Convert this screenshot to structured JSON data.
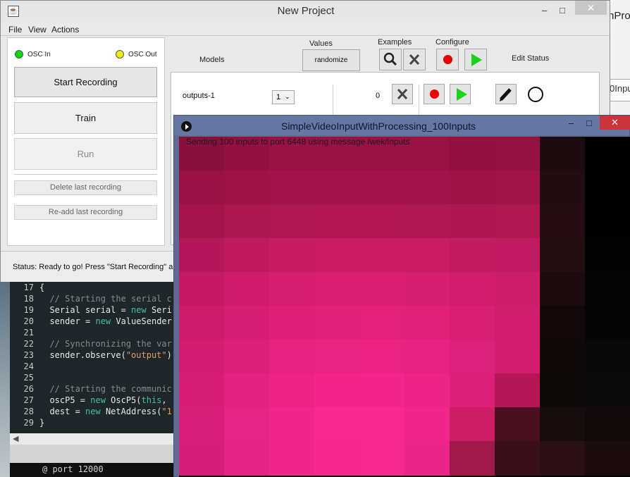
{
  "main_window": {
    "title": "New Project",
    "menu": [
      "File",
      "View",
      "Actions"
    ],
    "minimize": "‒",
    "maximize": "□",
    "close": "✕",
    "osc_in": {
      "label": "OSC In",
      "color": "#00dd00"
    },
    "osc_out": {
      "label": "OSC Out",
      "color": "#eeee00"
    },
    "buttons": {
      "start_recording": "Start Recording",
      "train": "Train",
      "run": "Run",
      "delete_last": "Delete last recording",
      "readd_last": "Re-add last recording"
    },
    "headers": {
      "models": "Models",
      "values": "Values",
      "examples": "Examples",
      "configure": "Configure",
      "edit_status": "Edit  Status"
    },
    "randomize": "randomize",
    "model_row": {
      "name": "outputs-1",
      "value": "1",
      "examples": "0"
    },
    "status": "Status:  Ready to go! Press \"Start Recording\" a"
  },
  "right_window": {
    "title_fragment": "nProc",
    "text_fragment": "0Inpu"
  },
  "editor": {
    "lines": [
      {
        "n": "17",
        "parts": [
          {
            "c": "tx",
            "t": "{"
          }
        ]
      },
      {
        "n": "18",
        "parts": [
          {
            "c": "cm",
            "t": "  // Starting the serial c"
          }
        ]
      },
      {
        "n": "19",
        "parts": [
          {
            "c": "tx",
            "t": "  Serial serial = "
          },
          {
            "c": "kw",
            "t": "new"
          },
          {
            "c": "tx",
            "t": " Seri"
          }
        ]
      },
      {
        "n": "20",
        "parts": [
          {
            "c": "tx",
            "t": "  sender = "
          },
          {
            "c": "kw",
            "t": "new"
          },
          {
            "c": "tx",
            "t": " ValueSender"
          }
        ]
      },
      {
        "n": "21",
        "parts": []
      },
      {
        "n": "22",
        "parts": [
          {
            "c": "cm",
            "t": "  // Synchronizing the var"
          }
        ]
      },
      {
        "n": "23",
        "parts": [
          {
            "c": "tx",
            "t": "  sender.observe("
          },
          {
            "c": "st",
            "t": "\"output\""
          },
          {
            "c": "tx",
            "t": ")"
          }
        ]
      },
      {
        "n": "24",
        "parts": []
      },
      {
        "n": "25",
        "parts": []
      },
      {
        "n": "26",
        "parts": [
          {
            "c": "cm",
            "t": "  // Starting the communic"
          }
        ]
      },
      {
        "n": "27",
        "parts": [
          {
            "c": "tx",
            "t": "  oscP5 = "
          },
          {
            "c": "kw",
            "t": "new"
          },
          {
            "c": "tx",
            "t": " OscP5("
          },
          {
            "c": "kw",
            "t": "this"
          },
          {
            "c": "tx",
            "t": ","
          }
        ]
      },
      {
        "n": "28",
        "parts": [
          {
            "c": "tx",
            "t": "  dest = "
          },
          {
            "c": "kw",
            "t": "new"
          },
          {
            "c": "tx",
            "t": " NetAddress("
          },
          {
            "c": "st",
            "t": "\"1"
          }
        ]
      },
      {
        "n": "29",
        "parts": [
          {
            "c": "tx",
            "t": "}"
          }
        ]
      }
    ],
    "console": "@ port 12000"
  },
  "sketch_window": {
    "title": "SimpleVideoInputWithProcessing_100Inputs",
    "minimize": "‒",
    "maximize": "□",
    "close": "✕",
    "message": "Sending 100 inputs to port 6448 using message /wek/inputs",
    "grid_colors": [
      [
        "#8a0f3c",
        "#941040",
        "#991243",
        "#9a1244",
        "#9a1244",
        "#991243",
        "#941040",
        "#951141",
        "#1c0c10",
        "#000000"
      ],
      [
        "#981245",
        "#9e1346",
        "#a1134a",
        "#a3134b",
        "#a3134b",
        "#a1134a",
        "#9e1346",
        "#a01447",
        "#220e12",
        "#000000"
      ],
      [
        "#a4144b",
        "#ac164f",
        "#b01651",
        "#b21652",
        "#b21652",
        "#b01651",
        "#ad1650",
        "#ae1750",
        "#250e13",
        "#000000"
      ],
      [
        "#b5175a",
        "#c01a5e",
        "#c71b62",
        "#cb1c64",
        "#cc1c64",
        "#c91c63",
        "#c21b60",
        "#c01b60",
        "#230e12",
        "#020202"
      ],
      [
        "#c41a64",
        "#d01c6a",
        "#d61d6e",
        "#da1e70",
        "#db1e70",
        "#d81e6f",
        "#d11d6b",
        "#cc1d69",
        "#1c0c10",
        "#040404"
      ],
      [
        "#cc1c6a",
        "#d81e72",
        "#df1f76",
        "#e32078",
        "#e42078",
        "#e11f76",
        "#da1e72",
        "#d01d6c",
        "#120809",
        "#050505"
      ],
      [
        "#d21d70",
        "#de1f78",
        "#e6217e",
        "#ea2280",
        "#ec2281",
        "#e82180",
        "#dd2079",
        "#d11e6f",
        "#0e0808",
        "#080808"
      ],
      [
        "#d61e74",
        "#e4217e",
        "#ed2384",
        "#f22488",
        "#f3248a",
        "#ee2386",
        "#dc2078",
        "#b51656",
        "#0c0808",
        "#0a0a0a"
      ],
      [
        "#d81f77",
        "#e72383",
        "#f2268a",
        "#f8288f",
        "#f92890",
        "#f2268a",
        "#cc1d65",
        "#4b1020",
        "#160b0d",
        "#120a0a"
      ],
      [
        "#d51f76",
        "#e52382",
        "#f0268a",
        "#f6288e",
        "#f7288e",
        "#ee2588",
        "#a0194a",
        "#3a0e1a",
        "#2a1015",
        "#1a0c0e"
      ]
    ]
  }
}
